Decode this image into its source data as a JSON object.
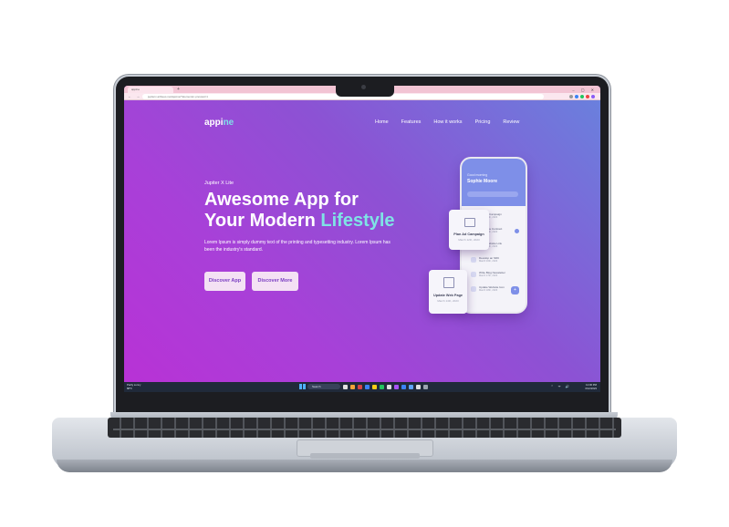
{
  "browser": {
    "tab_title": "appine",
    "new_tab": "+",
    "window_controls": "– ▢ ✕",
    "nav_icons": "← → ⟳",
    "url": "jupiterx.artbees.net/appine/?elementor-preview=1"
  },
  "site": {
    "logo_main": "appi",
    "logo_accent": "ne",
    "nav": [
      "Home",
      "Features",
      "How it works",
      "Pricing",
      "Review"
    ],
    "kicker": "Jupiter X Lite",
    "headline_line1": "Awesome App for",
    "headline_line2_plain": "Your Modern ",
    "headline_line2_highlight": "Lifestyle",
    "description": "Lorem Ipsum is simply dummy text of the printing and typesetting industry. Lorem Ipsum has been the industry's standard.",
    "button_primary": "Discover App",
    "button_secondary": "Discover More"
  },
  "phone": {
    "greeting": "Good morning",
    "user_name": "Sophie Moore",
    "rows": [
      {
        "title": "Plan Ad Campaign",
        "sub": "March 12th, 2023"
      },
      {
        "title": "Set Office Contract",
        "sub": "March 14th, 2023"
      },
      {
        "title": "Send Website Link",
        "sub": "March 15th, 2023"
      },
      {
        "title": "Develop an SDK",
        "sub": "March 16th, 2023"
      },
      {
        "title": "Write Blog Newsletter",
        "sub": "March 17th, 2023"
      },
      {
        "title": "Update Website Icon",
        "sub": "March 18th, 2023"
      }
    ],
    "fab": "+"
  },
  "cards": {
    "card1_title": "Plan Ad Campaign",
    "card1_sub": "March 12th, 2023",
    "card2_title": "Update Web Page",
    "card2_sub": "March 14th, 2023"
  },
  "taskbar": {
    "weather_line1": "Partly sunny",
    "weather_line2": "88°F",
    "search": "Search",
    "tray_icons": "⌃ ᯤ 🔊",
    "time": "12:00 PM",
    "date": "6/12/2023",
    "app_colors": [
      "#e0e0e0",
      "#f2a33a",
      "#d64545",
      "#3b82f6",
      "#facc15",
      "#22c55e",
      "#e0e0e0",
      "#a855f7",
      "#3b82f6",
      "#60a5fa",
      "#e0e0e0",
      "#9ca3af"
    ]
  },
  "colors": {
    "hero_gradient_start": "#6a80dd",
    "hero_gradient_end": "#b832d6",
    "accent_cyan": "#7fe3e5",
    "button_bg": "#f4e1f4",
    "button_text": "#7b3fc2"
  }
}
